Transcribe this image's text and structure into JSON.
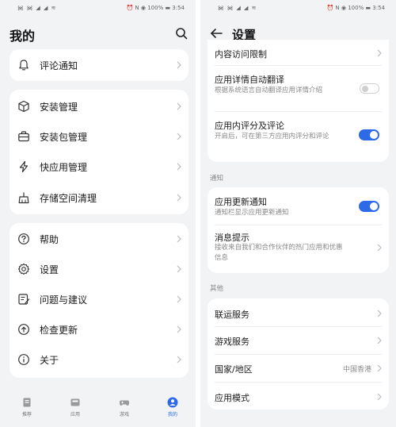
{
  "left": {
    "status": {
      "signal": "᯼ ᯼ ◢ ◢ ≋",
      "right": "⏰ N ◉ 100% ▬ 3:54"
    },
    "title": "我的",
    "cards": [
      {
        "items": [
          {
            "label": "评论通知",
            "icon": "bell-icon"
          }
        ]
      },
      {
        "items": [
          {
            "label": "安装管理",
            "icon": "cube-icon"
          },
          {
            "label": "安装包管理",
            "icon": "briefcase-icon"
          },
          {
            "label": "快应用管理",
            "icon": "lightning-icon"
          },
          {
            "label": "存储空间清理",
            "icon": "broom-icon"
          }
        ]
      },
      {
        "items": [
          {
            "label": "帮助",
            "icon": "help-icon"
          },
          {
            "label": "设置",
            "icon": "gear-icon"
          },
          {
            "label": "问题与建议",
            "icon": "feedback-icon"
          },
          {
            "label": "检查更新",
            "icon": "update-icon"
          },
          {
            "label": "关于",
            "icon": "info-icon"
          }
        ]
      }
    ],
    "tabs": [
      {
        "label": "推荐",
        "icon": "recommend-icon",
        "active": false
      },
      {
        "label": "应用",
        "icon": "apps-icon",
        "active": false
      },
      {
        "label": "游戏",
        "icon": "gamepad-icon",
        "active": false
      },
      {
        "label": "我的",
        "icon": "profile-icon",
        "active": true
      }
    ]
  },
  "right": {
    "status": {
      "signal": "᯼ ᯼ ◢ ◢ ≋",
      "right": "⏰ N ◉ 100% ▬ 3:54"
    },
    "title": "设置",
    "card1": {
      "item0": "内容访问限制",
      "item1": {
        "title": "应用详情自动翻译",
        "sub": "根据系统语言自动翻译应用详情介绍",
        "toggle": false
      },
      "item2": {
        "title": "应用内评分及评论",
        "sub": "开启后，可在第三方应用内评分和评论",
        "toggle": true
      }
    },
    "section_notify": "通知",
    "card2": {
      "item1": {
        "title": "应用更新通知",
        "sub": "通知栏显示应用更新通知",
        "toggle": true
      },
      "item2": {
        "title": "消息提示",
        "sub": "接收来自我们和合作伙伴的热门应用和优惠信息"
      }
    },
    "section_other": "其他",
    "card3": [
      {
        "title": "联运服务",
        "value": ""
      },
      {
        "title": "游戏服务",
        "value": ""
      },
      {
        "title": "国家/地区",
        "value": "中国香港"
      },
      {
        "title": "应用模式",
        "value": ""
      }
    ]
  },
  "colors": {
    "accent": "#2d6ae8",
    "background": "#f1f3f5",
    "card": "#ffffff"
  }
}
